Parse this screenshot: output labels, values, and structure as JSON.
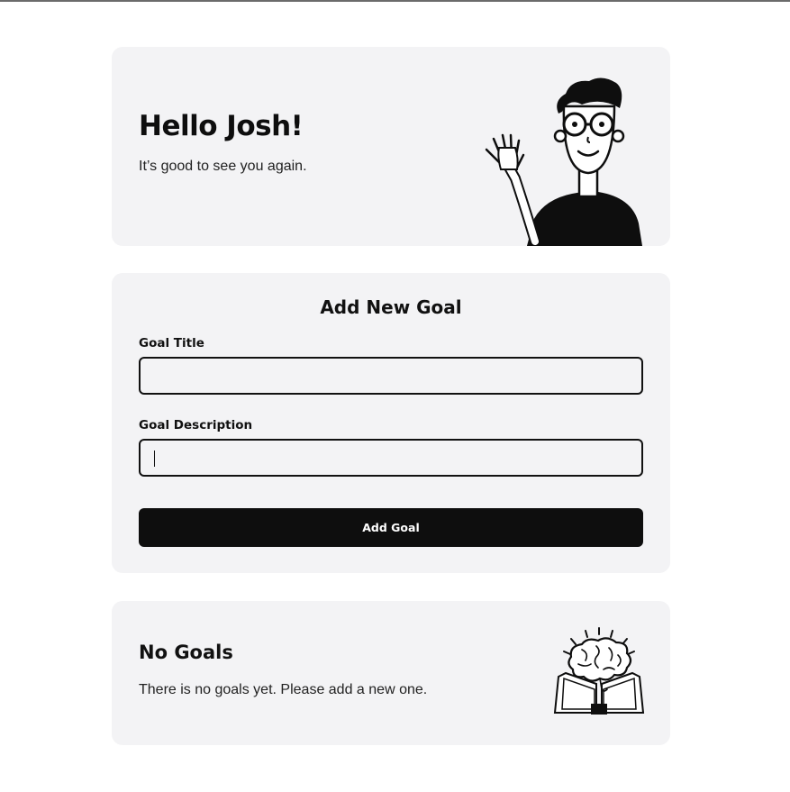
{
  "greeting": {
    "title": "Hello Josh!",
    "subtitle": "It’s good to see you again.",
    "illustration": "waving-person-illustration"
  },
  "form": {
    "heading": "Add New Goal",
    "title_label": "Goal Title",
    "title_value": "",
    "description_label": "Goal Description",
    "description_value": "",
    "submit_label": "Add Goal"
  },
  "empty_state": {
    "title": "No Goals",
    "message": "There is no goals yet. Please add a new one.",
    "illustration": "brain-book-illustration"
  },
  "colors": {
    "card_bg": "#f3f3f5",
    "primary": "#0e0e0e",
    "text": "#111111"
  }
}
